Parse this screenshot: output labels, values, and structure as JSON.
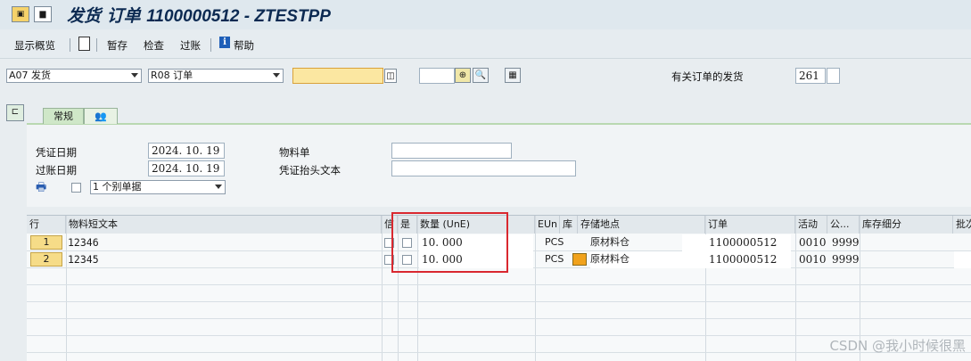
{
  "title": {
    "prefix": "发货 订单 ",
    "number": "1100000512",
    "suffix": " - ZTESTPP"
  },
  "toolbar": {
    "display_overview": "显示概览",
    "hold": "暂存",
    "check": "检查",
    "post": "过账",
    "help": "帮助"
  },
  "selection": {
    "transaction": "A07 发货",
    "reference": "R08 订单",
    "order_input": "",
    "blank_input": "",
    "related_label": "有关订单的发货",
    "related_value": "261"
  },
  "tabs": {
    "general": "常规"
  },
  "header": {
    "doc_date_label": "凭证日期",
    "doc_date": "2024. 10. 19",
    "post_date_label": "过账日期",
    "post_date": "2024. 10. 19",
    "material_slip_label": "物料单",
    "material_slip": "",
    "header_text_label": "凭证抬头文本",
    "header_text": "",
    "print_option": "1 个别单据"
  },
  "table": {
    "columns": {
      "line": "行",
      "material_text": "物料短文本",
      "c1": "信",
      "c2": "是",
      "quantity": "数量 (UnE)",
      "unit": "EUn",
      "stock": "库",
      "storage_location": "存储地点",
      "order": "订单",
      "activity": "活动",
      "plant": "公...",
      "stock_detail": "库存细分",
      "batch": "批次"
    },
    "rows": [
      {
        "line": "1",
        "material_text": "12346",
        "quantity": "10. 000",
        "unit": "PCS",
        "storage_location": "原材料仓",
        "order": "1100000512",
        "activity": "0010",
        "plant": "9999"
      },
      {
        "line": "2",
        "material_text": "12345",
        "quantity": "10. 000",
        "unit": "PCS",
        "storage_location": "原材料仓",
        "order": "1100000512",
        "activity": "0010",
        "plant": "9999"
      }
    ]
  },
  "watermark": "CSDN @我小时候很黑",
  "colors": {
    "highlight": "#d9282f",
    "input_yellow": "#fbe7a1"
  }
}
